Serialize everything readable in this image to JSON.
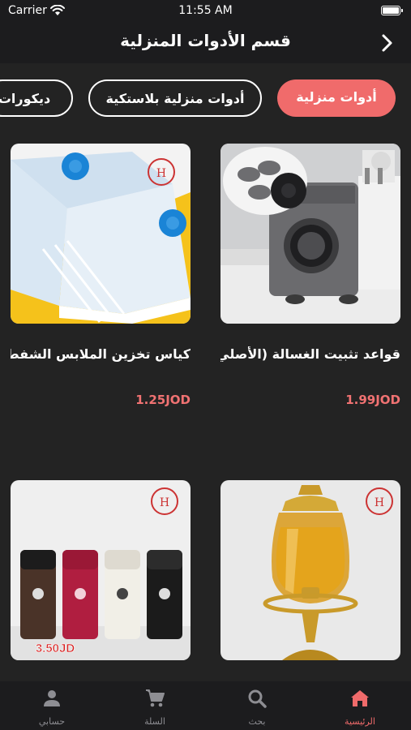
{
  "status_bar": {
    "carrier": "Carrier",
    "time": "11:55 AM"
  },
  "header": {
    "title": "قسم الأدوات المنزلية"
  },
  "categories": [
    {
      "label": "أدوات منزلية",
      "active": true
    },
    {
      "label": "أدوات منزلية بلاستكية",
      "active": false
    },
    {
      "label": "ديكورات",
      "active": false
    }
  ],
  "products": [
    {
      "name": "قواعد تثبيت الغسالة (الأصلي)",
      "price": "1.99JOD",
      "image": "washing-machine-feet"
    },
    {
      "name": "كياس تخزين الملابس الشفط",
      "price": "1.25JOD",
      "image": "vacuum-storage-bags"
    },
    {
      "name": "",
      "price": "",
      "image": "gold-glass-dispenser"
    },
    {
      "name": "",
      "price": "",
      "image": "travel-mugs",
      "image_price_tag": "3.50JD"
    }
  ],
  "tabs": [
    {
      "label": "الرئيسية",
      "icon": "home-icon",
      "active": true
    },
    {
      "label": "بحث",
      "icon": "search-icon",
      "active": false
    },
    {
      "label": "السلة",
      "icon": "cart-icon",
      "active": false
    },
    {
      "label": "حسابي",
      "icon": "person-icon",
      "active": false
    }
  ],
  "colors": {
    "accent": "#f06b6b",
    "background": "#232323",
    "bar": "#1c1c1e",
    "price": "#f07272"
  }
}
